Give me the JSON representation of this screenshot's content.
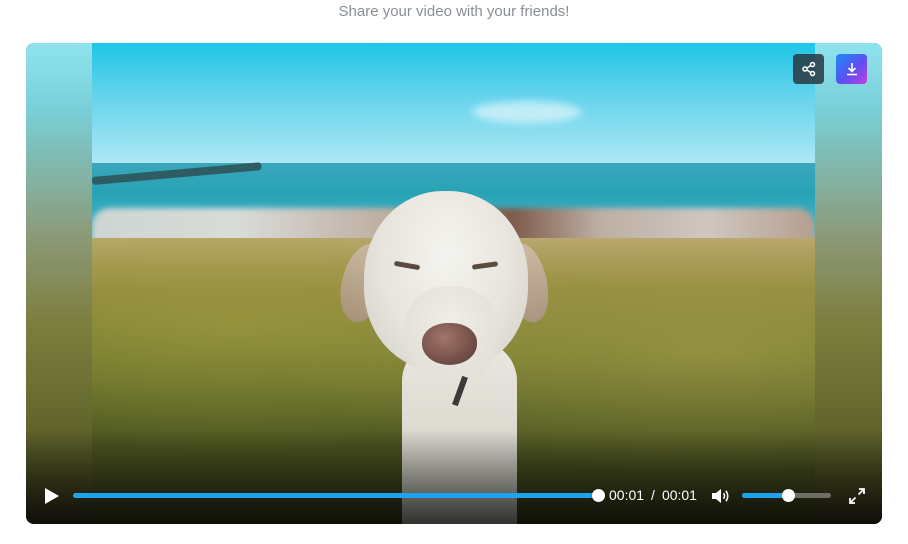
{
  "header": {
    "subtitle": "Share your video with your friends!"
  },
  "player": {
    "share_icon": "share-icon",
    "download_icon": "download-icon",
    "play_icon": "play-icon",
    "volume_icon": "volume-icon",
    "fullscreen_icon": "fullscreen-icon",
    "current_time": "00:01",
    "time_separator": "/",
    "duration": "00:01",
    "progress_percent": 100,
    "volume_percent": 52,
    "accent_color": "#1ba3ef"
  }
}
